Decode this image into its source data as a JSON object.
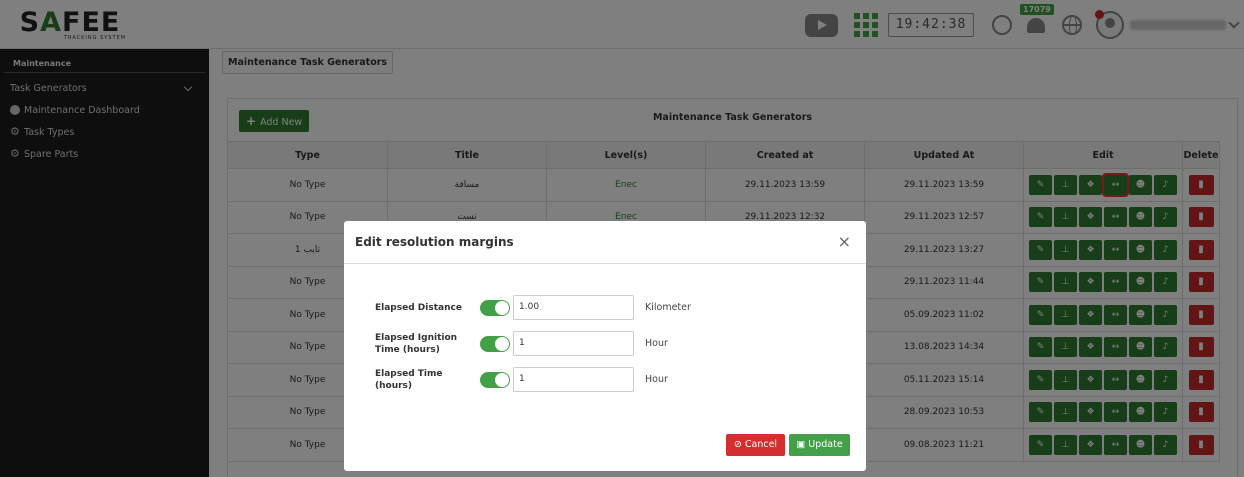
{
  "header": {
    "logo": "SAFEE",
    "logo_sub": "TRACKING SYSTEM",
    "clock": "19:42:38",
    "notifications_count": "17079",
    "icons": [
      "youtube-icon",
      "apps-grid-icon",
      "location-icon",
      "bell-icon",
      "globe-icon",
      "avatar-icon"
    ]
  },
  "sidebar": {
    "section": "Maintenance",
    "items": [
      {
        "label": "Task Generators",
        "icon": "chevron-down-icon"
      },
      {
        "label": "Maintenance Dashboard",
        "icon": "dashboard-icon"
      },
      {
        "label": "Task Types",
        "icon": "gear-icon"
      },
      {
        "label": "Spare Parts",
        "icon": "gear-icon"
      }
    ]
  },
  "main": {
    "breadcrumb": "Maintenance Task Generators",
    "card_title": "Maintenance Task Generators",
    "add_new": "Add New",
    "columns": [
      "Type",
      "Title",
      "Level(s)",
      "Created at",
      "Updated At",
      "Edit",
      "Delete"
    ],
    "rows": [
      {
        "type": "No Type",
        "title": "مسافة",
        "level": "Enec",
        "created": "29.11.2023 13:59",
        "updated": "29.11.2023 13:59"
      },
      {
        "type": "No Type",
        "title": "تست",
        "level": "Enec",
        "created": "29.11.2023 12:32",
        "updated": "29.11.2023 12:57"
      },
      {
        "type": "تايب 1",
        "title": "",
        "level": "",
        "created": "",
        "updated": "29.11.2023 13:27"
      },
      {
        "type": "No Type",
        "title": "",
        "level": "",
        "created": "",
        "updated": "29.11.2023 11:44"
      },
      {
        "type": "No Type",
        "title": "",
        "level": "",
        "created": "",
        "updated": "05.09.2023 11:02"
      },
      {
        "type": "No Type",
        "title": "",
        "level": "",
        "created": "",
        "updated": "13.08.2023 14:34"
      },
      {
        "type": "No Type",
        "title": "",
        "level": "",
        "created": "",
        "updated": "05.11.2023 15:14"
      },
      {
        "type": "No Type",
        "title": "",
        "level": "",
        "created": "",
        "updated": "28.09.2023 10:53"
      },
      {
        "type": "No Type",
        "title": "",
        "level": "",
        "created": "",
        "updated": "09.08.2023 11:21"
      }
    ],
    "edit_icons": [
      "edit-icon",
      "hierarchy-icon",
      "cubes-icon",
      "arrows-h-icon",
      "users-icon",
      "bell-icon"
    ],
    "selected_edit_icon": "arrows-h-icon",
    "delete_icon": "trash-icon"
  },
  "modal": {
    "title": "Edit resolution margins",
    "close": "×",
    "fields": [
      {
        "label": "Elapsed Distance",
        "value": "1.00",
        "unit": "Kilometer",
        "enabled": true
      },
      {
        "label": "Elapsed Ignition Time (hours)",
        "value": "1",
        "unit": "Hour",
        "enabled": true
      },
      {
        "label": "Elapsed Time (hours)",
        "value": "1",
        "unit": "Hour",
        "enabled": true
      }
    ],
    "cancel": "Cancel",
    "update": "Update"
  }
}
